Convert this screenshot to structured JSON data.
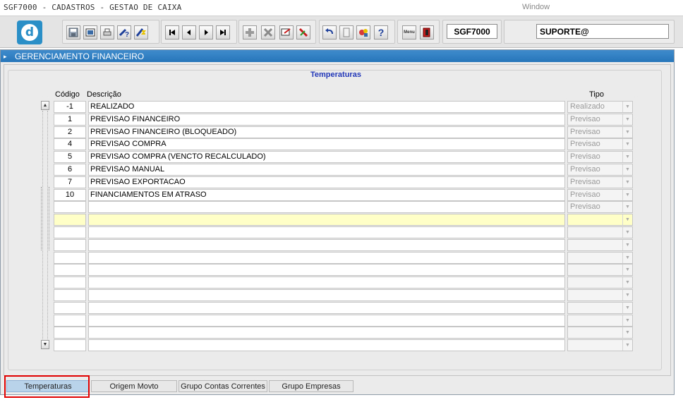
{
  "titlebar": {
    "title": "SGF7000 - CADASTROS - GESTAO DE CAIXA",
    "window_menu": "Window"
  },
  "toolbar": {
    "form_code": "SGF7000",
    "user": "SUPORTE@",
    "icons": [
      "save-icon",
      "print-preview-icon",
      "print-icon",
      "query-help-icon",
      "execute-query-icon",
      "first-record-icon",
      "previous-record-icon",
      "next-record-icon",
      "last-record-icon",
      "insert-record-icon",
      "delete-record-icon",
      "duplicate-icon",
      "clear-icon",
      "undo-icon",
      "copy-icon",
      "settings-icon",
      "help-icon",
      "menu-icon",
      "exit-icon"
    ],
    "help_glyph": "?",
    "menu_glyph": "Menu"
  },
  "window": {
    "header_title": "GERENCIAMENTO FINANCEIRO",
    "frame_title": "Temperaturas"
  },
  "grid": {
    "headers": {
      "code": "Código",
      "description": "Descrição",
      "tipo": "Tipo"
    },
    "rows": [
      {
        "code": "-1",
        "description": "REALIZADO",
        "tipo": "Realizado"
      },
      {
        "code": "1",
        "description": "PREVISAO FINANCEIRO",
        "tipo": "Previsao"
      },
      {
        "code": "2",
        "description": "PREVISAO FINANCEIRO (BLOQUEADO)",
        "tipo": "Previsao"
      },
      {
        "code": "4",
        "description": "PREVISAO COMPRA",
        "tipo": "Previsao"
      },
      {
        "code": "5",
        "description": "PREVISAO COMPRA (VENCTO RECALCULADO)",
        "tipo": "Previsao"
      },
      {
        "code": "6",
        "description": "PREVISAO MANUAL",
        "tipo": "Previsao"
      },
      {
        "code": "7",
        "description": "PREVISAO EXPORTACAO",
        "tipo": "Previsao"
      },
      {
        "code": "10",
        "description": "FINANCIAMENTOS EM ATRASO",
        "tipo": "Previsao"
      },
      {
        "code": "",
        "description": "",
        "tipo": "Previsao"
      },
      {
        "code": "",
        "description": "",
        "tipo": ""
      },
      {
        "code": "",
        "description": "",
        "tipo": ""
      },
      {
        "code": "",
        "description": "",
        "tipo": ""
      },
      {
        "code": "",
        "description": "",
        "tipo": ""
      },
      {
        "code": "",
        "description": "",
        "tipo": ""
      },
      {
        "code": "",
        "description": "",
        "tipo": ""
      },
      {
        "code": "",
        "description": "",
        "tipo": ""
      },
      {
        "code": "",
        "description": "",
        "tipo": ""
      },
      {
        "code": "",
        "description": "",
        "tipo": ""
      },
      {
        "code": "",
        "description": "",
        "tipo": ""
      },
      {
        "code": "",
        "description": "",
        "tipo": ""
      }
    ],
    "active_row": 9
  },
  "tabs": [
    {
      "label": "Temperaturas",
      "selected": true
    },
    {
      "label": "Origem Movto",
      "selected": false
    },
    {
      "label": "Grupo Contas Correntes",
      "selected": false
    },
    {
      "label": "Grupo Empresas",
      "selected": false
    }
  ],
  "colors": {
    "accent": "#2776bb",
    "frame_title": "#2338b8",
    "active_row": "#ffffc8",
    "highlight": "#e00000"
  }
}
